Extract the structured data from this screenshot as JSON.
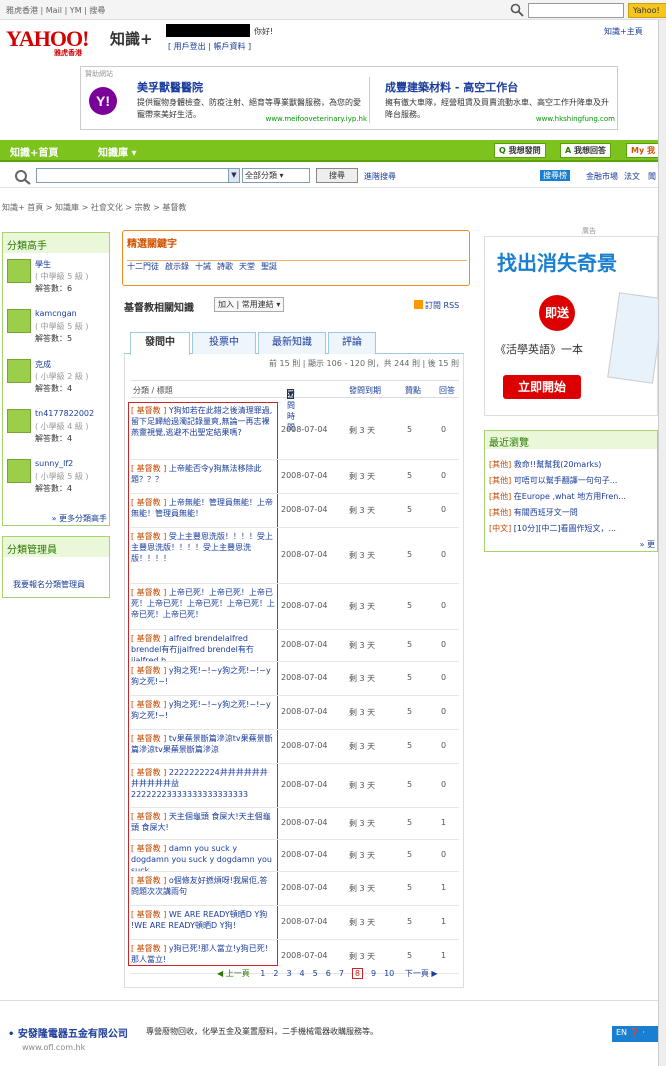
{
  "top": {
    "links": "雅虎香港 | Mail | YM | 搜尋",
    "search_placeholder": "",
    "search_btn": "Yahoo!"
  },
  "header": {
    "logo": "YAHOO!",
    "logo_sub": "雅虎香港",
    "brand": "知識+",
    "hello": "你好!",
    "userlinks": "[ 用戶登出 | 帳戶資料 ]",
    "home": "知識+主頁"
  },
  "sponsor": {
    "label": "贊助網站",
    "ads": [
      {
        "title": "美孚獸醫醫院",
        "desc": "提供寵物身體檢查、防疫注射、絕育等專業獸醫服務，為您的愛寵帶來美好生活。",
        "url": "www.meifooveterinary.iyp.hk"
      },
      {
        "title": "成豐建築材料 - 高空工作台",
        "desc": "擁有徹大車隊，經營租賃及買賣流動水車、高空工作升降車及升降台服務。",
        "url": "www.hkshingfung.com"
      }
    ]
  },
  "nav": {
    "home": "知識+首頁",
    "library": "知識庫",
    "ask": "我想發問",
    "answer": "我想回答",
    "mine": "My 我"
  },
  "search": {
    "category": "全部分類",
    "button": "搜尋",
    "advanced": "進階搜尋",
    "tag": "搜尋榜",
    "related1": "金融市場",
    "related2": "法文",
    "related3": "聞"
  },
  "breadcrumb": "知識+ 首頁 > 知識庫 > 社會文化 > 宗教 > 基督教",
  "experts": {
    "title": "分類高手",
    "items": [
      {
        "name": "學生",
        "level": "( 中學級 5 級 )",
        "answers": "解答數：6"
      },
      {
        "name": "kamcngan",
        "level": "( 中學級 5 級 )",
        "answers": "解答數：5"
      },
      {
        "name": "克成",
        "level": "( 小學級 2 級 )",
        "answers": "解答數：4"
      },
      {
        "name": "tn4177822002",
        "level": "( 小學級 4 級 )",
        "answers": "解答數：4"
      },
      {
        "name": "sunny_lf2",
        "level": "( 小學級 5 級 )",
        "answers": "解答數：4"
      }
    ],
    "more": "» 更多分類高手"
  },
  "manager": {
    "title": "分類管理員",
    "link": "我要報名分類管理員"
  },
  "keywords": {
    "title": "精選關鍵字",
    "tags": [
      "十二門徒",
      "啟示錄",
      "十誡",
      "詩歌",
      "天堂",
      "聖誕"
    ]
  },
  "list": {
    "title": "基督教相關知識",
    "add": "加入 | 常用連結",
    "rss": "訂閱 RSS",
    "tabs": [
      "發問中",
      "投票中",
      "最新知識",
      "評論"
    ],
    "pager_top": "前 15 則 | 顯示 106 - 120 則，共 244 則 | 後 15 則",
    "cols": [
      "分類 / 標題",
      "發問時間",
      "發問到期",
      "贊點",
      "回答"
    ],
    "rows": [
      {
        "cat": "[ 基督教 ]",
        "title": "Y狗如若在此錯之後清理罪過,留下足歸給過濁記錄量爽,無論一再志裸燕靈視覺,逃避不出聖定結果嗎?",
        "date": "2008-07-04",
        "due": "剩 3 天",
        "pts": "5",
        "ans": "0"
      },
      {
        "cat": "[ 基督教 ]",
        "title": "上帝能否令y狗無法移除此題？？？",
        "date": "2008-07-04",
        "due": "剩 3 天",
        "pts": "5",
        "ans": "0"
      },
      {
        "cat": "[ 基督教 ]",
        "title": "上帝無能！管理員無能！上帝無能！管理員無能！",
        "date": "2008-07-04",
        "due": "剩 3 天",
        "pts": "5",
        "ans": "0"
      },
      {
        "cat": "[ 基督教 ]",
        "title": "受上主豐恩洗版！！！！受上主豐恩洗版！！！！受上主豐恩洗版！！！！",
        "date": "2008-07-04",
        "due": "剩 3 天",
        "pts": "5",
        "ans": "0"
      },
      {
        "cat": "[ 基督教 ]",
        "title": "上帝已死！上帝已死！上帝已死！上帝已死！上帝已死！上帝已死！上帝已死！上帝已死！",
        "date": "2008-07-04",
        "due": "剩 3 天",
        "pts": "5",
        "ans": "0"
      },
      {
        "cat": "[ 基督教 ]",
        "title": "alfred brendelalfred brendel有冇jjalfred brendel有冇jjalfred b",
        "date": "2008-07-04",
        "due": "剩 3 天",
        "pts": "5",
        "ans": "0"
      },
      {
        "cat": "[ 基督教 ]",
        "title": "y狗之死!~!~y狗之死!~!~y狗之死!~!",
        "date": "2008-07-04",
        "due": "剩 3 天",
        "pts": "5",
        "ans": "0"
      },
      {
        "cat": "[ 基督教 ]",
        "title": "y狗之死!~!~y狗之死!~!~y狗之死!~!",
        "date": "2008-07-04",
        "due": "剩 3 天",
        "pts": "5",
        "ans": "0"
      },
      {
        "cat": "[ 基督教 ]",
        "title": "tv果蕪景斷篇滲涼tv果蕪景斷篇滲涼tv果蕪景斷篇滲涼",
        "date": "2008-07-04",
        "due": "剩 3 天",
        "pts": "5",
        "ans": "0"
      },
      {
        "cat": "[ 基督教 ]",
        "title": "2222222224井井井井井井井井井井井益22222223333333333333333",
        "date": "2008-07-04",
        "due": "剩 3 天",
        "pts": "5",
        "ans": "0"
      },
      {
        "cat": "[ 基督教 ]",
        "title": "天主個龜頭 食屎大!天主個龜頭 食屎大!",
        "date": "2008-07-04",
        "due": "剩 3 天",
        "pts": "5",
        "ans": "1"
      },
      {
        "cat": "[ 基督教 ]",
        "title": "damn you suck y dogdamn you suck y dogdamn you suck",
        "date": "2008-07-04",
        "due": "剩 3 天",
        "pts": "5",
        "ans": "0"
      },
      {
        "cat": "[ 基督教 ]",
        "title": "o個條友好撚煩呀!我屌佢,答問題次次講雨句",
        "date": "2008-07-04",
        "due": "剩 3 天",
        "pts": "5",
        "ans": "1"
      },
      {
        "cat": "[ 基督教 ]",
        "title": "WE ARE READY頓晒D Y狗 !WE ARE READY頓晒D Y狗！",
        "date": "2008-07-04",
        "due": "剩 3 天",
        "pts": "5",
        "ans": "1"
      },
      {
        "cat": "[ 基督教 ]",
        "title": "y狗已死!那人當立!y狗已死!那人當立!",
        "date": "2008-07-04",
        "due": "剩 3 天",
        "pts": "5",
        "ans": "1"
      }
    ],
    "pager_bot": {
      "prev": "◀ 上一頁",
      "pages": [
        "1",
        "2",
        "3",
        "4",
        "5",
        "6",
        "7",
        "8",
        "9",
        "10"
      ],
      "current": "8",
      "next": "下一頁 ▶"
    }
  },
  "rightad": {
    "label": "廣告",
    "headline": "找出消失奇景",
    "circle": "即送",
    "text": "《活學英語》一本",
    "button": "立即開始"
  },
  "recent": {
    "title": "最近瀏覽",
    "items": [
      {
        "tag": "[其他]",
        "text": "救命!!幫幫我(20marks)"
      },
      {
        "tag": "[其他]",
        "text": "可唔可以幫手翻譯一句句子..."
      },
      {
        "tag": "[其他]",
        "text": "在Europe ,what 地方用Fren..."
      },
      {
        "tag": "[其他]",
        "text": "有關西班牙文一問"
      },
      {
        "tag": "[中文]",
        "text": "[10分][中二]看圖作短文，..."
      }
    ],
    "more": "» 更"
  },
  "footer_ad": {
    "title": "安發隆電器五金有限公司",
    "desc": "專營廢物回收，化學五金及業置廢料，二手機械電器收購服務等。",
    "url": "www.ofl.com.hk"
  },
  "langbar": "EN ❓ ·"
}
